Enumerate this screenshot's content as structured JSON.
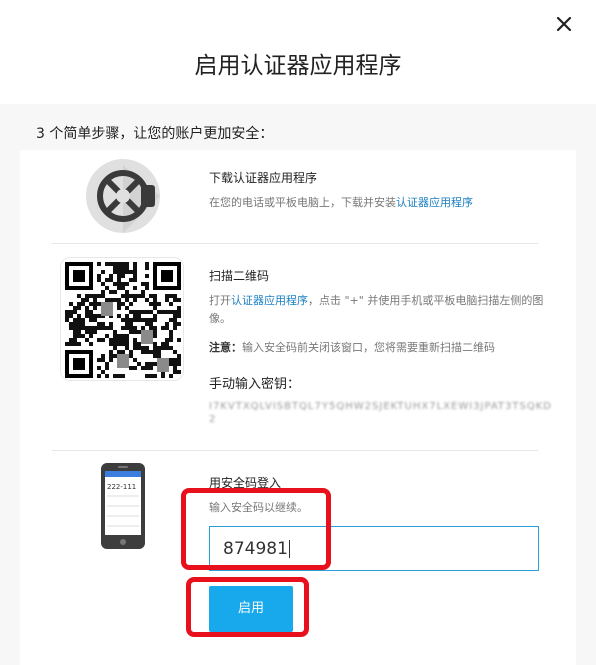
{
  "dialog": {
    "title": "启用认证器应用程序"
  },
  "intro": "3 个简单步骤，让您的账户更加安全：",
  "step1": {
    "title": "下载认证器应用程序",
    "desc_prefix": "在您的电话或平板电脑上，下载并安装",
    "desc_link": "认证器应用程序"
  },
  "step2": {
    "title": "扫描二维码",
    "desc_prefix": "打开",
    "desc_link": "认证器应用程序",
    "desc_suffix": "，点击 \"+\" 并使用手机或平板电脑扫描左侧的图像。",
    "note_label": "注意：",
    "note_text": "输入安全码前关闭该窗口，您将需要重新扫描二维码",
    "manual_label": "手动输入密钥：",
    "secret_key": "I7KVTXQLVISBTQL7Y5QHW2SJEKTUHX7LXEWI3JPAT3TSQKD2"
  },
  "step3": {
    "title": "用安全码登入",
    "desc": "输入安全码以继续。",
    "code_value": "874981",
    "enable_button": "启用",
    "phone_screen_text": "222-111"
  },
  "colors": {
    "accent": "#18a9ec",
    "link": "#1a7fc1",
    "highlight": "#e8101d"
  },
  "icons": {
    "close": "close-icon",
    "authenticator": "authenticator-app-icon",
    "phone": "phone-icon"
  }
}
